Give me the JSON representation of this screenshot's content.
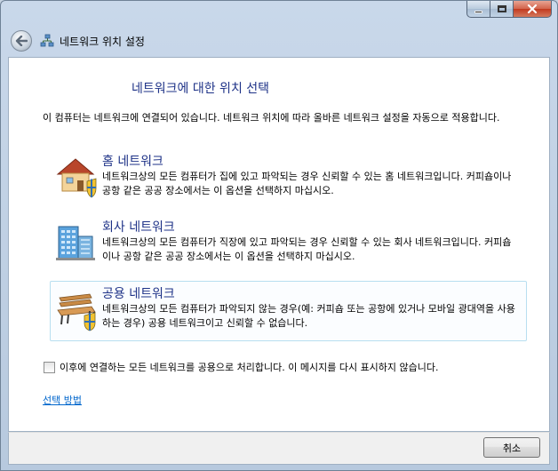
{
  "window": {
    "nav_title": "네트워크 위치 설정"
  },
  "content": {
    "heading": "네트워크에 대한 위치 선택",
    "intro": "이 컴퓨터는 네트워크에 연결되어 있습니다. 네트워크 위치에 따라 올바른 네트워크 설정을 자동으로 적용합니다.",
    "options": [
      {
        "title": "홈 네트워크",
        "desc": "네트워크상의 모든 컴퓨터가 집에 있고 파악되는 경우 신뢰할 수 있는 홈 네트워크입니다. 커피숍이나 공항 같은 공공 장소에서는 이 옵션을 선택하지 마십시오.",
        "icon": "home-icon"
      },
      {
        "title": "회사 네트워크",
        "desc": "네트워크상의 모든 컴퓨터가 직장에 있고 파악되는 경우 신뢰할 수 있는 회사 네트워크입니다. 커피숍이나 공항 같은 공공 장소에서는 이 옵션을 선택하지 마십시오.",
        "icon": "office-building-icon"
      },
      {
        "title": "공용 네트워크",
        "desc": "네트워크상의 모든 컴퓨터가 파악되지 않는 경우(예: 커피숍 또는 공항에 있거나 모바일 광대역을 사용하는 경우) 공용 네트워크이고 신뢰할 수 없습니다.",
        "icon": "park-bench-icon"
      }
    ],
    "checkbox_label": "이후에 연결하는 모든 네트워크를 공용으로 처리합니다. 이 메시지를 다시 표시하지 않습니다.",
    "checkbox_checked": false,
    "help_link": "선택 방법"
  },
  "footer": {
    "cancel_label": "취소"
  },
  "colors": {
    "heading": "#1e3287",
    "link": "#0066cc",
    "hover_border": "#b8dff0"
  }
}
